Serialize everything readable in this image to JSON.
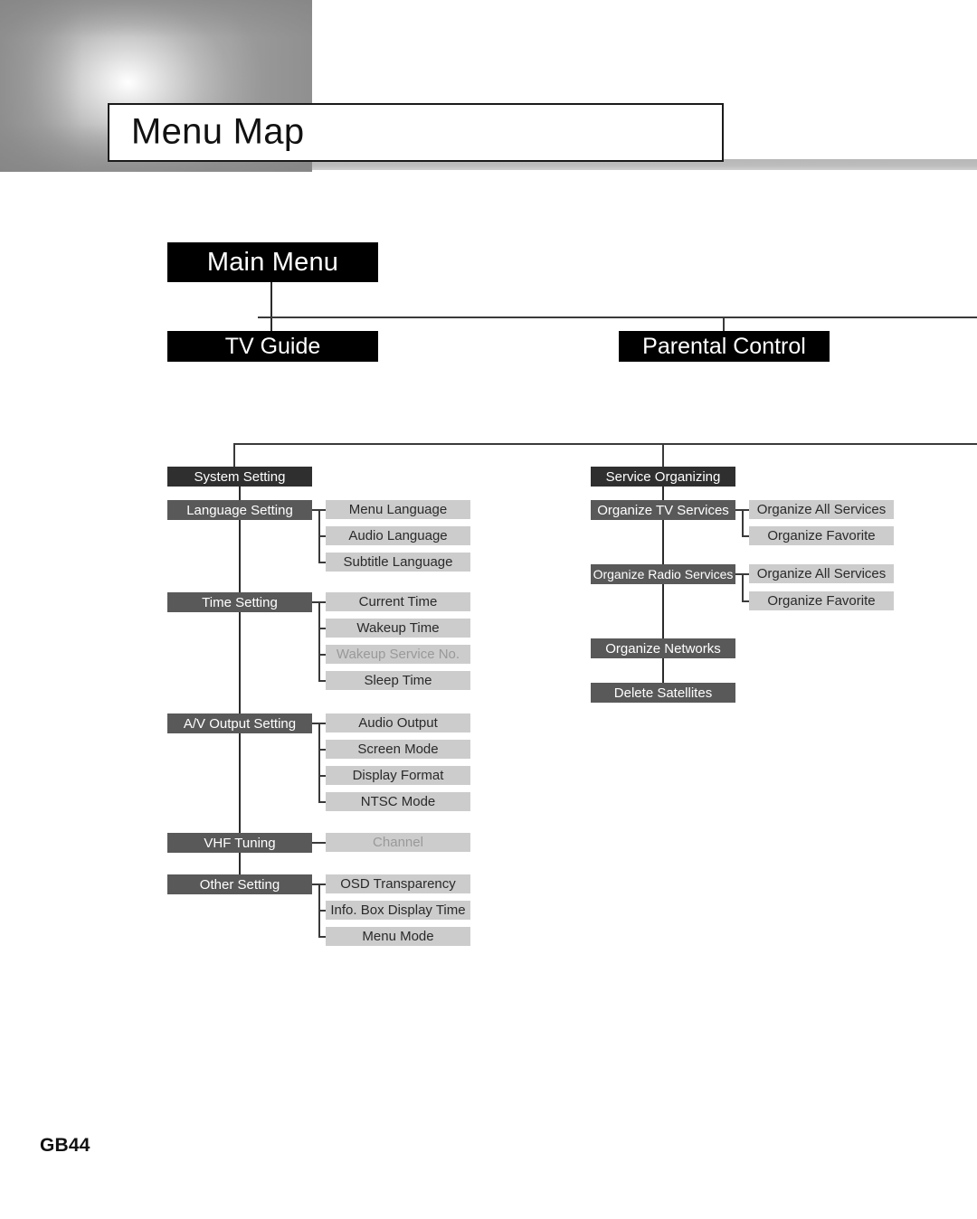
{
  "page": {
    "title": "Menu Map",
    "page_number": "GB44",
    "colors": {
      "root_box": "#000000",
      "section_heading": "#2f2f2f",
      "group_box": "#595959",
      "leaf_box": "#cccccc",
      "connector": "#2b2b2b",
      "disabled_text": "#999999"
    }
  },
  "tree": {
    "root": {
      "label": "Main Menu"
    },
    "level1": [
      {
        "label": "TV Guide"
      },
      {
        "label": "Parental Control"
      }
    ],
    "columns": [
      {
        "heading": {
          "label": "System Setting"
        },
        "groups": [
          {
            "label": "Language Setting",
            "children": [
              {
                "label": "Menu Language",
                "disabled": false
              },
              {
                "label": "Audio Language",
                "disabled": false
              },
              {
                "label": "Subtitle Language",
                "disabled": false
              }
            ]
          },
          {
            "label": "Time Setting",
            "children": [
              {
                "label": "Current Time",
                "disabled": false
              },
              {
                "label": "Wakeup Time",
                "disabled": false
              },
              {
                "label": "Wakeup Service No.",
                "disabled": true
              },
              {
                "label": "Sleep Time",
                "disabled": false
              }
            ]
          },
          {
            "label": "A/V Output Setting",
            "children": [
              {
                "label": "Audio Output",
                "disabled": false
              },
              {
                "label": "Screen Mode",
                "disabled": false
              },
              {
                "label": "Display Format",
                "disabled": false
              },
              {
                "label": "NTSC Mode",
                "disabled": false
              }
            ]
          },
          {
            "label": "VHF Tuning",
            "children": [
              {
                "label": "Channel",
                "disabled": true
              }
            ]
          },
          {
            "label": "Other Setting",
            "children": [
              {
                "label": "OSD Transparency",
                "disabled": false
              },
              {
                "label": "Info. Box Display Time",
                "disabled": false
              },
              {
                "label": "Menu Mode",
                "disabled": false
              }
            ]
          }
        ]
      },
      {
        "heading": {
          "label": "Service Organizing"
        },
        "groups": [
          {
            "label": "Organize TV Services",
            "children": [
              {
                "label": "Organize All Services",
                "disabled": false
              },
              {
                "label": "Organize Favorite",
                "disabled": false
              }
            ]
          },
          {
            "label": "Organize Radio Services",
            "children": [
              {
                "label": "Organize All Services",
                "disabled": false
              },
              {
                "label": "Organize Favorite",
                "disabled": false
              }
            ]
          },
          {
            "label": "Organize Networks",
            "children": []
          },
          {
            "label": "Delete Satellites",
            "children": []
          }
        ]
      }
    ]
  }
}
